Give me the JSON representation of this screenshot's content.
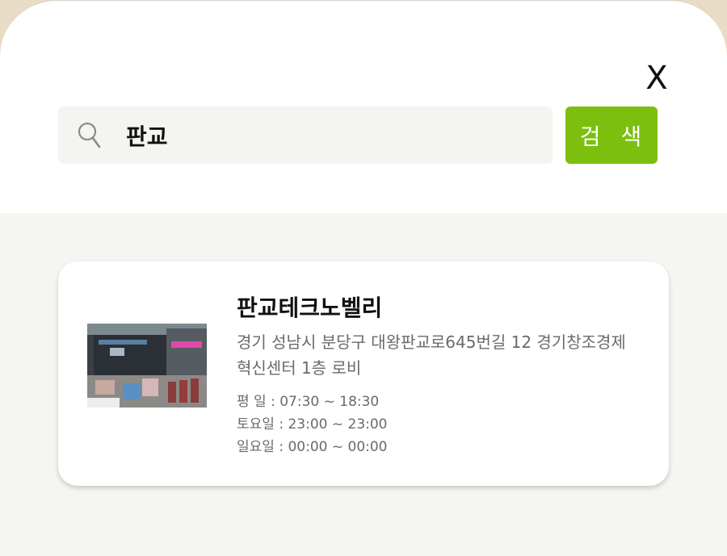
{
  "close_label": "X",
  "search": {
    "value": "판교",
    "button_label": "검 색"
  },
  "results": [
    {
      "name": "판교테크노벨리",
      "address": "경기 성남시 분당구 대왕판교로645번길 12 경기창조경제혁신센터 1층 로비",
      "hours": [
        "평    일 : 07:30 ~ 18:30",
        "토요일 : 23:00 ~ 23:00",
        "일요일 : 00:00 ~ 00:00"
      ]
    }
  ],
  "colors": {
    "accent": "#7dbf0e",
    "search_bg": "#f4f4f1",
    "results_bg": "#f5f5f2"
  }
}
